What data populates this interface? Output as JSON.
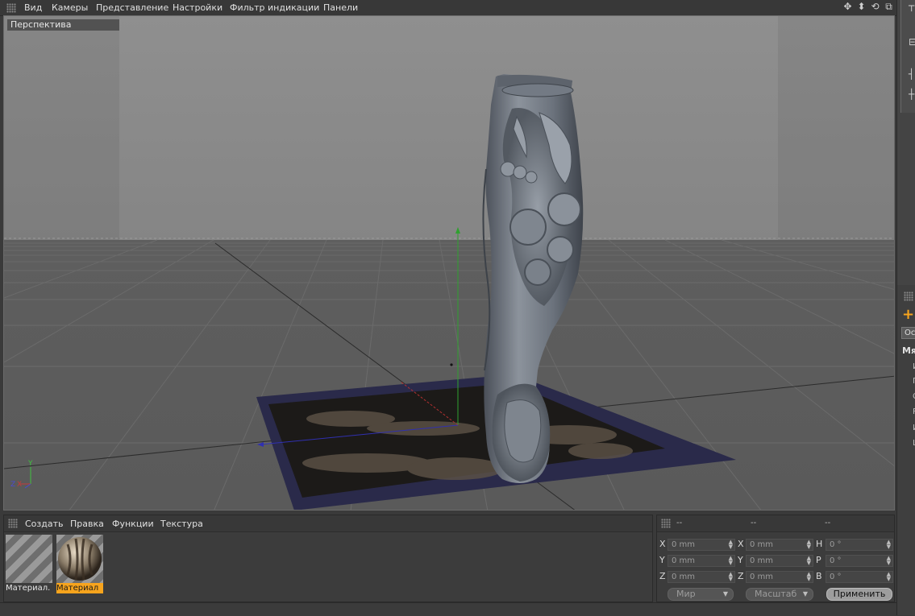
{
  "menubar": {
    "items": [
      "Вид",
      "Камеры",
      "Представление",
      "Настройки",
      "Фильтр индикации",
      "Панели"
    ],
    "nav_icons": [
      "move-view-icon",
      "zoom-view-icon",
      "rotate-view-icon",
      "toggle-layout-icon"
    ]
  },
  "viewport": {
    "label": "Перспектива",
    "axis_labels": {
      "y": "Y",
      "z": "Z",
      "x": "X"
    }
  },
  "material_manager": {
    "menu": [
      "Создать",
      "Правка",
      "Функции",
      "Текстура"
    ],
    "materials": [
      {
        "label": "Материал.",
        "selected": false
      },
      {
        "label": "Материал",
        "selected": true
      }
    ]
  },
  "coordinates": {
    "columns": [
      "--",
      "--",
      "--"
    ],
    "rows": [
      {
        "pos_axis": "X",
        "pos_value": "0 mm",
        "size_axis": "X",
        "size_value": "0 mm",
        "rot_axis": "H",
        "rot_value": "0 °"
      },
      {
        "pos_axis": "Y",
        "pos_value": "0 mm",
        "size_axis": "Y",
        "size_value": "0 mm",
        "rot_axis": "P",
        "rot_value": "0 °"
      },
      {
        "pos_axis": "Z",
        "pos_value": "0 mm",
        "size_axis": "Z",
        "size_value": "0 mm",
        "rot_axis": "B",
        "rot_value": "0 °"
      }
    ],
    "mode_world": "Мир",
    "mode_scale": "Масштаб",
    "apply_label": "Применить"
  },
  "attributes_partial": {
    "button": "Ос",
    "heading": "Мя",
    "labels": [
      "И",
      "П",
      "С",
      "Р",
      "И",
      "L"
    ]
  },
  "colors": {
    "accent_orange": "#f7a41d",
    "ui_background": "#3a3a3a",
    "viewport_sky": "#8e8e8e",
    "floor_plane": "#2a2a4a"
  }
}
